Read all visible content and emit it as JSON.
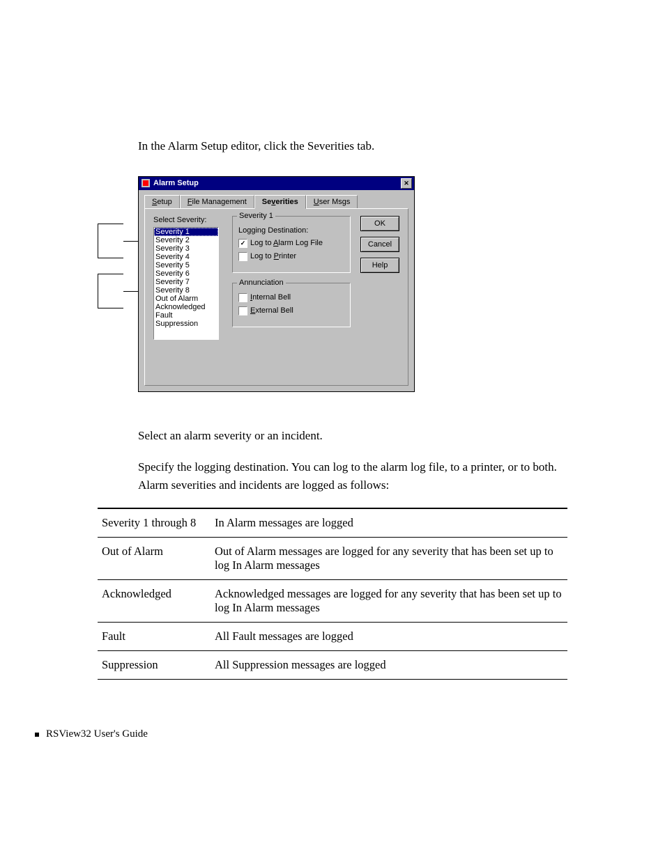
{
  "intro": "In the Alarm Setup editor, click the Severities tab.",
  "dialog": {
    "title": "Alarm Setup",
    "tabs": [
      "Setup",
      "File Management",
      "Severities",
      "User Msgs"
    ],
    "tab_underlines": [
      "S",
      "F",
      "v",
      "U"
    ],
    "active_tab_index": 2,
    "select_label": "Select Severity:",
    "list_items": [
      "Severity 1",
      "Severity 2",
      "Severity 3",
      "Severity 4",
      "Severity 5",
      "Severity 6",
      "Severity 7",
      "Severity 8",
      "Out of Alarm",
      "Acknowledged",
      "Fault",
      "Suppression"
    ],
    "selected_item_index": 0,
    "group1": {
      "title": "Severity 1",
      "sub_label": "Logging Destination:",
      "chk1": {
        "label": "Log to Alarm Log File",
        "checked": true,
        "ul": "A"
      },
      "chk2": {
        "label": "Log to Printer",
        "checked": false,
        "ul": "P"
      }
    },
    "group2": {
      "title": "Annunciation",
      "chk1": {
        "label": "Internal Bell",
        "checked": false,
        "ul": "I"
      },
      "chk2": {
        "label": "External Bell",
        "checked": false,
        "ul": "E"
      }
    },
    "buttons": {
      "ok": "OK",
      "cancel": "Cancel",
      "help": "Help"
    }
  },
  "step1": "Select an alarm severity or an incident.",
  "step2": "Specify the logging destination. You can log to the alarm log file, to a printer, or to both. Alarm severities and incidents are logged as follows:",
  "table": [
    {
      "name": "Severity 1 through 8",
      "desc": "In Alarm messages are logged"
    },
    {
      "name": "Out of Alarm",
      "desc": "Out of Alarm messages are logged for any severity that has been set up to log In Alarm messages"
    },
    {
      "name": "Acknowledged",
      "desc": "Acknowledged messages are logged for any severity that has been set up to log In Alarm messages"
    },
    {
      "name": "Fault",
      "desc": "All Fault messages are logged"
    },
    {
      "name": "Suppression",
      "desc": "All Suppression messages are logged"
    }
  ],
  "footer": "RSView32  User's Guide"
}
